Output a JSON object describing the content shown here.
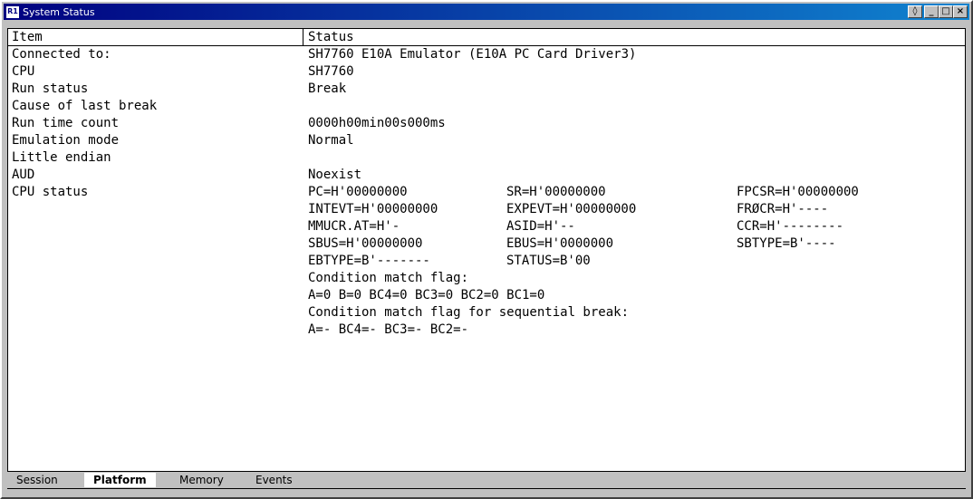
{
  "window": {
    "title": "System Status",
    "app_badge": "R1",
    "controls": {
      "restore": "◊",
      "minimize": "_",
      "maximize": "□",
      "close": "×"
    }
  },
  "table": {
    "columns": [
      "Item",
      "Status"
    ],
    "rows": [
      {
        "item": "Connected to:",
        "status": "SH7760 E10A Emulator (E10A PC Card Driver3)"
      },
      {
        "item": "CPU",
        "status": "SH7760"
      },
      {
        "item": "Run status",
        "status": "Break"
      },
      {
        "item": "Cause of last break",
        "status": ""
      },
      {
        "item": "Run time count",
        "status": "0000h00min00s000ms"
      },
      {
        "item": "Emulation mode",
        "status": "Normal"
      },
      {
        "item": "Little endian",
        "status": ""
      },
      {
        "item": "AUD",
        "status": "Noexist"
      },
      {
        "item": "CPU status",
        "status": ""
      }
    ],
    "cpu_status": [
      [
        "PC=H'00000000",
        "SR=H'00000000",
        "FPCSR=H'00000000"
      ],
      [
        "INTEVT=H'00000000",
        "EXPEVT=H'00000000",
        "FRØCR=H'----"
      ],
      [
        "MMUCR.AT=H'-",
        "ASID=H'--",
        "CCR=H'--------"
      ],
      [
        "SBUS=H'00000000",
        "EBUS=H'0000000",
        "SBTYPE=B'----"
      ],
      [
        "EBTYPE=B'-------",
        "STATUS=B'00",
        ""
      ]
    ],
    "condition_lines": [
      "Condition match flag:",
      "A=0 B=0 BC4=0 BC3=0 BC2=0 BC1=0",
      "Condition match flag for sequential break:",
      "A=- BC4=- BC3=- BC2=-"
    ]
  },
  "tabs": [
    {
      "label": "Session",
      "active": false
    },
    {
      "label": "Platform",
      "active": true
    },
    {
      "label": "Memory",
      "active": false
    },
    {
      "label": "Events",
      "active": false
    }
  ]
}
